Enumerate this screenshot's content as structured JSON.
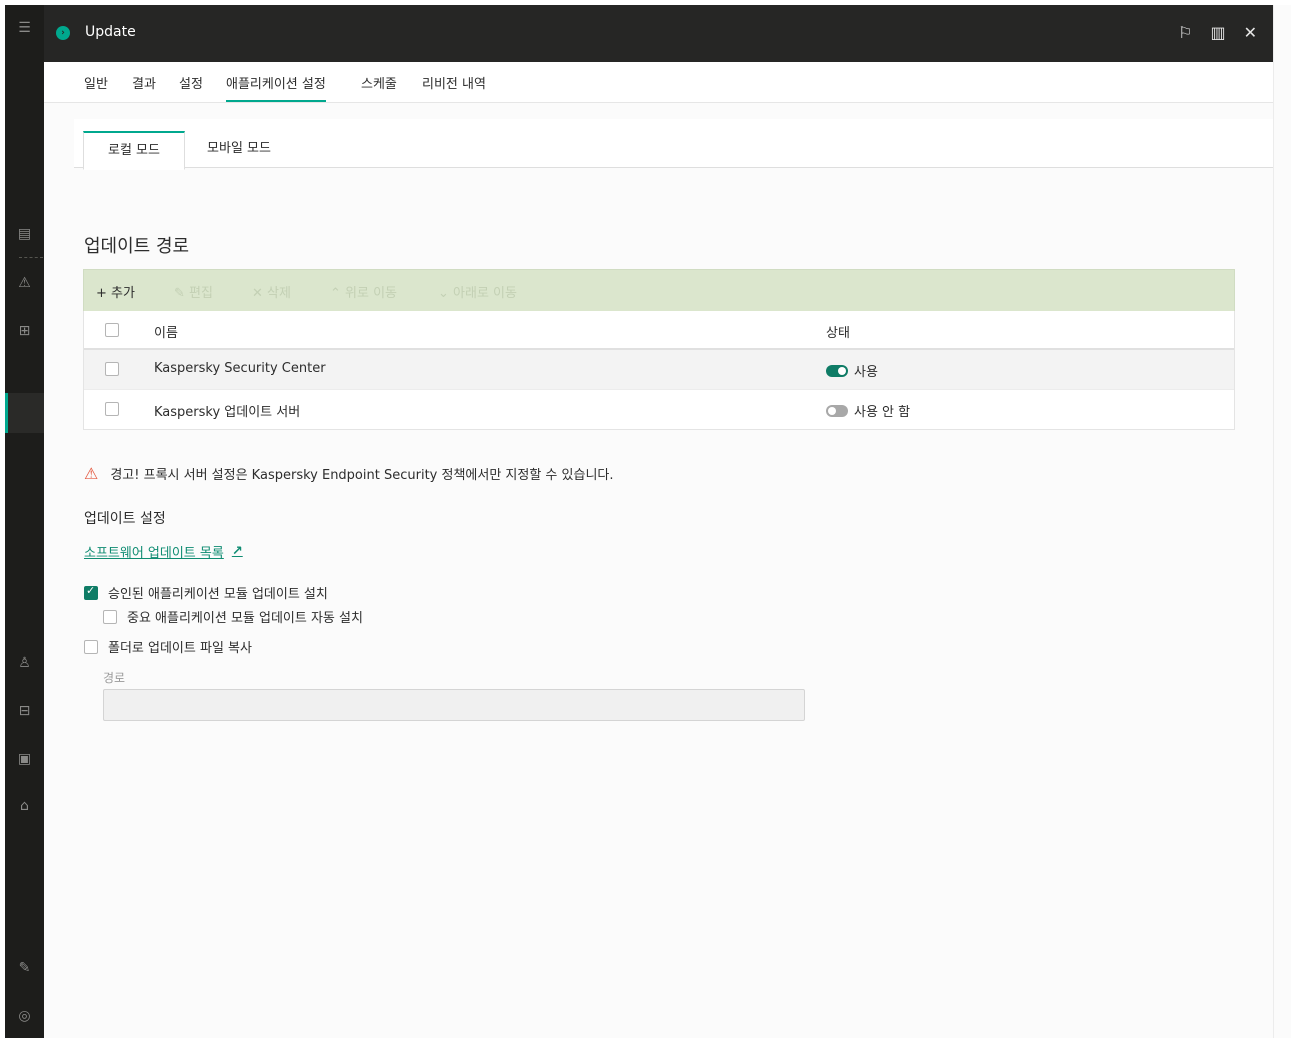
{
  "window": {
    "title": "Update",
    "actions": [
      "flag-icon",
      "book-icon",
      "close-icon"
    ]
  },
  "main_tabs": [
    {
      "label": "일반"
    },
    {
      "label": "결과"
    },
    {
      "label": "설정"
    },
    {
      "label": "애플리케이션 설정",
      "active": true
    },
    {
      "label": "스케줄"
    },
    {
      "label": "리비전 내역"
    }
  ],
  "sub_tabs": [
    {
      "label": "로컬 모드",
      "active": true
    },
    {
      "label": "모바일 모드"
    }
  ],
  "section_title": "업데이트 경로",
  "toolbar": {
    "add": "+ 추가",
    "edit": "✎ 편집",
    "delete": "✕ 삭제",
    "move_up": "⌃ 위로 이동",
    "move_down": "⌄ 아래로 이동"
  },
  "table": {
    "columns": [
      "이름",
      "상태"
    ],
    "rows": [
      {
        "name": "Kaspersky Security Center",
        "status": "사용",
        "enabled": true
      },
      {
        "name": "Kaspersky 업데이트 서버",
        "status": "사용 안 함",
        "enabled": false
      }
    ]
  },
  "warning": "경고! 프록시 서버 설정은 Kaspersky Endpoint Security 정책에서만 지정할 수 있습니다.",
  "update_settings": {
    "title": "업데이트 설정",
    "link": "소프트웨어 업데이트 목록",
    "options": [
      {
        "label": "승인된 애플리케이션 모듈 업데이트 설치",
        "checked": true
      },
      {
        "label": "중요 애플리케이션 모듈 업데이트 자동 설치",
        "checked": false
      },
      {
        "label": "폴더로 업데이트 파일 복사",
        "checked": false
      }
    ],
    "path_label": "경로",
    "path_value": ""
  },
  "colors": {
    "accent": "#00a88e",
    "toggle_on": "#0f7c66",
    "toolbar_bg": "#dbe6cd",
    "warning": "#e4583f",
    "link": "#0f8c72"
  }
}
